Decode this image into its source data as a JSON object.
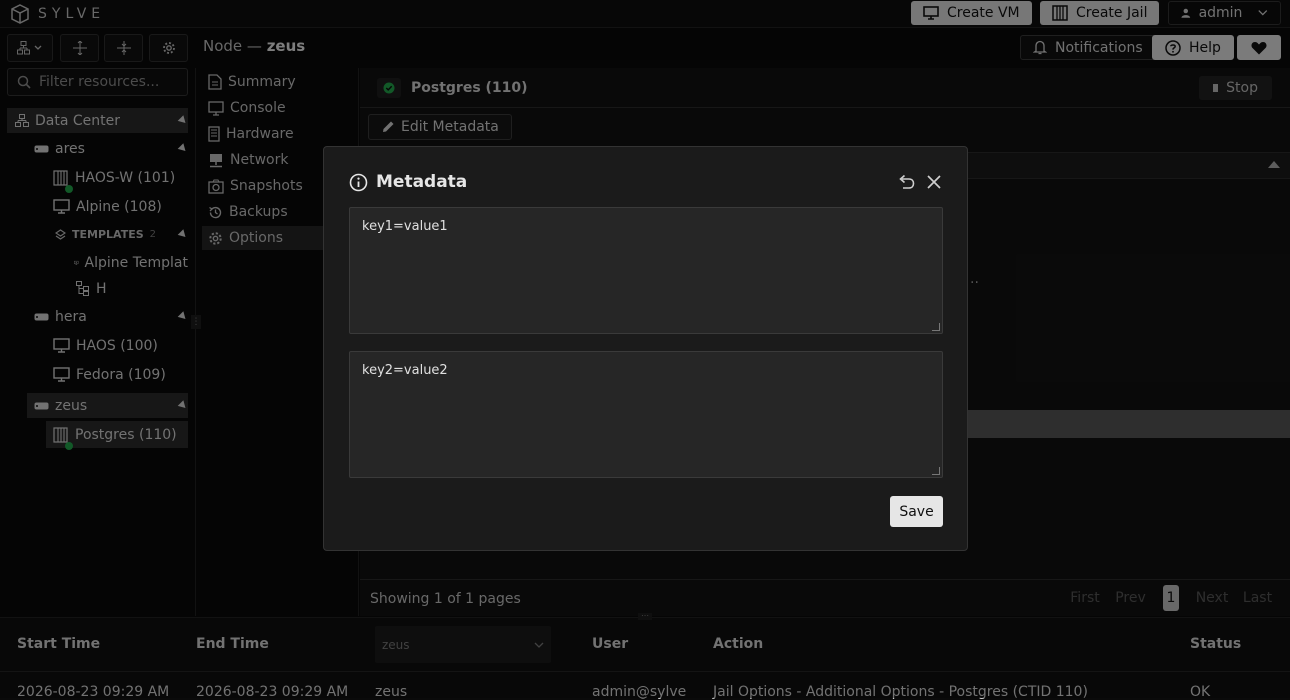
{
  "app": {
    "name": "SYLVE"
  },
  "topbar": {
    "create_vm": "Create VM",
    "create_jail": "Create Jail",
    "user": "admin"
  },
  "header": {
    "crumb_prefix": "Node —",
    "crumb_node": "zeus",
    "notifications": "Notifications",
    "help": "Help"
  },
  "sidebar": {
    "filter_placeholder": "Filter resources...",
    "datacenter": "Data Center",
    "nodes": [
      {
        "name": "ares"
      },
      {
        "name": "hera"
      },
      {
        "name": "zeus"
      }
    ],
    "ares_items": [
      "HAOS-W (101)",
      "Alpine (108)"
    ],
    "templates_label": "TEMPLATES",
    "templates_count": "2",
    "template_items": [
      "Alpine Templat",
      "H"
    ],
    "hera_items": [
      "HAOS (100)",
      "Fedora (109)"
    ],
    "zeus_items": [
      "Postgres (110)"
    ]
  },
  "nav": {
    "items": [
      "Summary",
      "Console",
      "Hardware",
      "Network",
      "Snapshots",
      "Backups",
      "Options"
    ],
    "active": "Options"
  },
  "content": {
    "title": "Postgres (110)",
    "stop": "Stop",
    "edit_metadata": "Edit Metadata",
    "ellipsis": "..",
    "showing": "Showing 1 of 1 pages",
    "pager": {
      "first": "First",
      "prev": "Prev",
      "page": "1",
      "next": "Next",
      "last": "Last"
    }
  },
  "modal": {
    "title": "Metadata",
    "field1": "key1=value1",
    "field2": "key2=value2",
    "save": "Save"
  },
  "log": {
    "headers": {
      "start": "Start Time",
      "end": "End Time",
      "node_select": "zeus",
      "user": "User",
      "action": "Action",
      "status": "Status"
    },
    "row": {
      "start": "2026-08-23 09:29 AM",
      "end": "2026-08-23 09:29 AM",
      "node": "zeus",
      "user": "admin@sylve",
      "action": "Jail Options - Additional Options - Postgres (CTID 110)",
      "status": "OK"
    }
  },
  "colors": {
    "status_ok": "#22a34a",
    "button_light": "#d9d9d9"
  }
}
